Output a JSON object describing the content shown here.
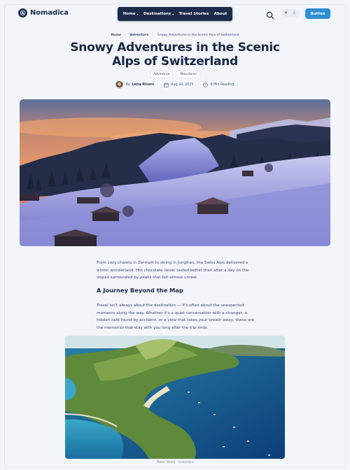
{
  "header": {
    "logo_text": "Nomadica",
    "nav": [
      {
        "label": "Home",
        "has_dropdown": true
      },
      {
        "label": "Destinations",
        "has_dropdown": true
      },
      {
        "label": "Travel Stories",
        "has_dropdown": false
      },
      {
        "label": "About",
        "has_dropdown": false
      }
    ],
    "caret": "▾",
    "search_icon": "search-icon",
    "theme_toggle": {
      "light": "☀",
      "dark": "☾"
    },
    "cta_label": "Button"
  },
  "breadcrumb": {
    "home": "Home",
    "category": "Adventure",
    "current": "Snowy Adventures in the Scenic Alps of Switzerland",
    "separator": "›"
  },
  "article": {
    "title": "Snowy Adventures in the Scenic Alps of Switzerland",
    "tags": [
      "Adventure",
      "Mountains"
    ],
    "author_prefix": "By",
    "author": "Lena Rivers",
    "date": "Aug 24, 2025",
    "read_time": "6 Min Reading",
    "intro": "From cozy chalets in Zermatt to skiing in Jungfrau, the Swiss Alps delivered a winter wonderland. Hot chocolate never tasted better than after a day on the slopes surrounded by peaks that felt almost unreal.",
    "section_heading": "A Journey Beyond the Map",
    "section_text": "Travel isn't always about the destination — it's often about the unexpected moments along the way. Whether it's a quiet conversation with a stranger, a hidden café found by accident, or a view that takes your breath away, these are the memories that stay with you long after the trip ends.",
    "image_caption": "Padar Island – Indonesia"
  },
  "colors": {
    "navy": "#1d2b4a",
    "accent": "#2f8fd4",
    "background": "#f1f4f9"
  }
}
